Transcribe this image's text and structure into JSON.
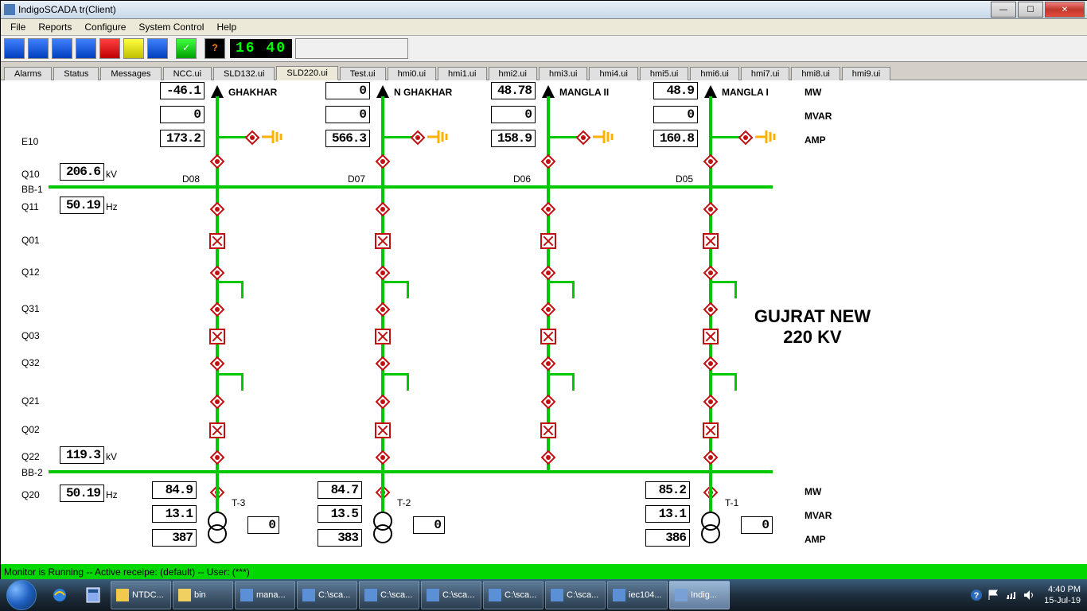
{
  "window": {
    "title": "IndigoSCADA tr(Client)"
  },
  "menu": [
    "File",
    "Reports",
    "Configure",
    "System Control",
    "Help"
  ],
  "clock": "16 40",
  "tabs": [
    "Alarms",
    "Status",
    "Messages",
    "NCC.ui",
    "SLD132.ui",
    "SLD220.ui",
    "Test.ui",
    "hmi0.ui",
    "hmi1.ui",
    "hmi2.ui",
    "hmi3.ui",
    "hmi4.ui",
    "hmi5.ui",
    "hmi6.ui",
    "hmi7.ui",
    "hmi8.ui",
    "hmi9.ui"
  ],
  "active_tab": 5,
  "left_labels": [
    "E10",
    "Q10",
    "BB-1",
    "Q11",
    "Q01",
    "Q12",
    "Q31",
    "Q03",
    "Q32",
    "Q21",
    "Q02",
    "Q22",
    "BB-2",
    "Q20"
  ],
  "q10": {
    "val": "206.6",
    "unit": "kV"
  },
  "q11": {
    "val": "50.19",
    "unit": "Hz"
  },
  "q22": {
    "val": "119.3",
    "unit": "kV"
  },
  "q20": {
    "val": "50.19",
    "unit": "Hz"
  },
  "right_labels": {
    "mw": "MW",
    "mvar": "MVAR",
    "amp": "AMP"
  },
  "feeds": [
    {
      "name": "GHAKHAR",
      "pos": "D08",
      "mw": "-46.1",
      "mvar": "0",
      "amp": "173.2"
    },
    {
      "name": "N GHAKHAR",
      "pos": "D07",
      "mw": "0",
      "mvar": "0",
      "amp": "566.3"
    },
    {
      "name": "MANGLA II",
      "pos": "D06",
      "mw": "48.78",
      "mvar": "0",
      "amp": "158.9"
    },
    {
      "name": "MANGLA I",
      "pos": "D05",
      "mw": "48.9",
      "mvar": "0",
      "amp": "160.8"
    }
  ],
  "xfmrs": [
    {
      "name": "T-3",
      "mw": "84.9",
      "mvar": "13.1",
      "amp": "387",
      "aux": "0"
    },
    {
      "name": "T-2",
      "mw": "84.7",
      "mvar": "13.5",
      "amp": "383",
      "aux": "0"
    },
    {
      "name": "T-1",
      "mw": "85.2",
      "mvar": "13.1",
      "amp": "386",
      "aux": "0"
    }
  ],
  "station": "GUJRAT NEW",
  "voltage": "220 KV",
  "status": "Monitor is Running -- Active receipe: (default) -- User: (***)",
  "tasks": [
    {
      "label": "NTDC..."
    },
    {
      "label": "bin"
    },
    {
      "label": "mana..."
    },
    {
      "label": "C:\\sca..."
    },
    {
      "label": "C:\\sca..."
    },
    {
      "label": "C:\\sca..."
    },
    {
      "label": "C:\\sca..."
    },
    {
      "label": "C:\\sca..."
    },
    {
      "label": "iec104..."
    },
    {
      "label": "Indig...",
      "active": true
    }
  ],
  "tray": {
    "time": "4:40 PM",
    "date": "15-Jul-19"
  }
}
